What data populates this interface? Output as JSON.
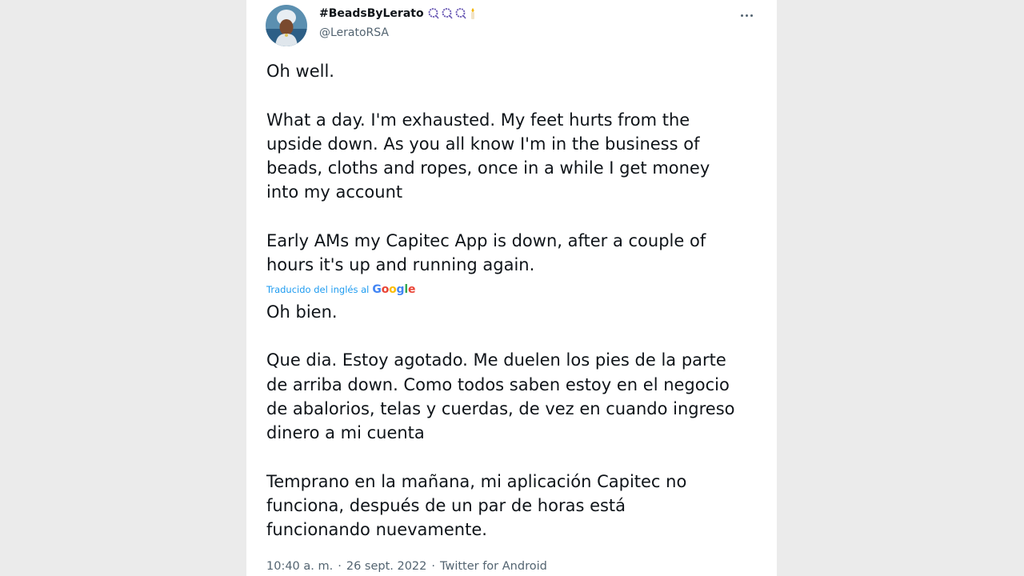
{
  "tweet": {
    "author": {
      "display_name": "#BeadsByLerato",
      "name_emojis": [
        "beads-icon",
        "beads-icon",
        "beads-icon",
        "candle-icon"
      ],
      "handle": "@LeratoRSA",
      "avatar_icon": "avatar-icon"
    },
    "more_icon": "more-horizontal-icon",
    "original_text": {
      "p1": "Oh well.",
      "p2_lines": [
        "What a day. I'm exhausted. My feet hurts from the",
        "upside down. As you all know I'm in the business of",
        "beads, cloths and ropes, once in a while I get money",
        "into my account"
      ],
      "p3_lines": [
        "Early AMs my Capitec App is down, after a couple of",
        "hours it's up and running again."
      ]
    },
    "translation": {
      "label": "Traducido del inglés al",
      "provider": "Google",
      "provider_colors": [
        "#4285f4",
        "#ea4335",
        "#fbbc05",
        "#4285f4",
        "#34a853",
        "#ea4335"
      ]
    },
    "translated_text": {
      "p1": "Oh bien.",
      "p2_lines": [
        "Que dia. Estoy agotado. Me duelen los pies de la parte",
        "de arriba down. Como todos saben estoy en el negocio",
        "de abalorios, telas y cuerdas, de vez en cuando ingreso",
        "dinero a mi cuenta"
      ],
      "p3_lines": [
        "Temprano en la mañana, mi aplicación Capitec no",
        "funciona, después de un par de horas está",
        "funcionando nuevamente."
      ]
    },
    "meta": {
      "time": "10:40 a. m.",
      "separator": "·",
      "date": "26 sept. 2022",
      "source": "Twitter for Android"
    }
  },
  "colors": {
    "background": "#ebebeb",
    "card": "#ffffff",
    "text_primary": "#0f1419",
    "text_secondary": "#536471",
    "link_blue": "#1d9bf0",
    "bead_purple": "#6b5bb5"
  }
}
